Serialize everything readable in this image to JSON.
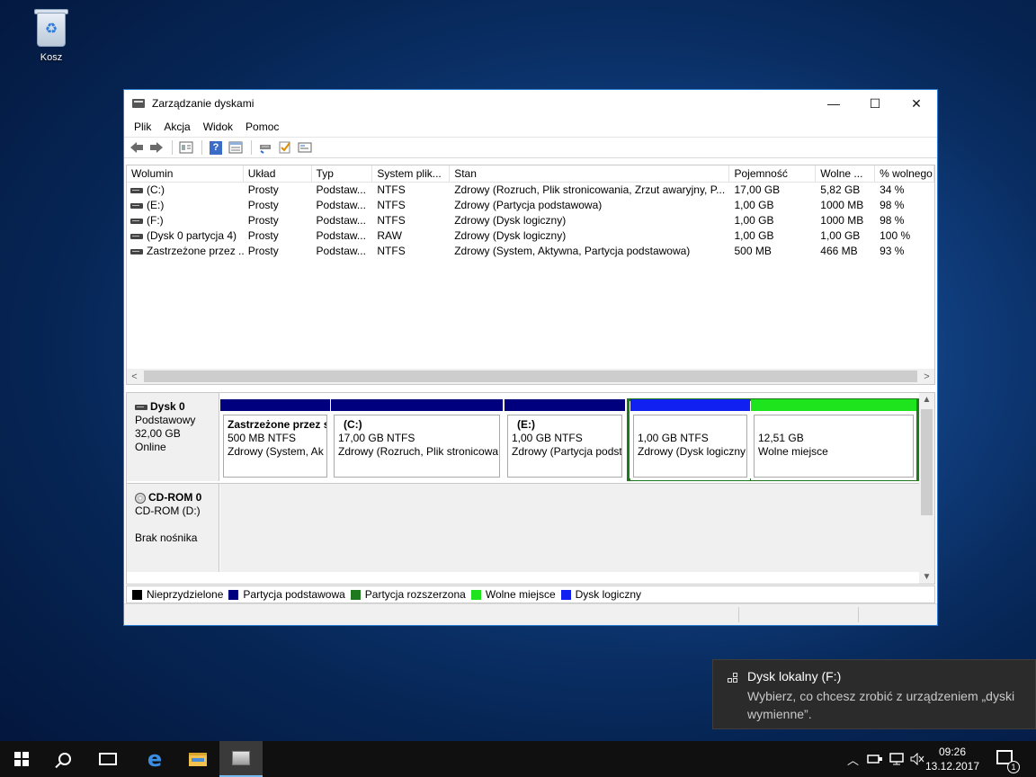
{
  "desktop": {
    "recycle_bin_label": "Kosz"
  },
  "window": {
    "title": "Zarządzanie dyskami",
    "controls": {
      "minimize": "—",
      "maximize": "☐",
      "close": "✕"
    },
    "menu": [
      "Plik",
      "Akcja",
      "Widok",
      "Pomoc"
    ],
    "toolbar_icons": [
      "back-icon",
      "forward-icon",
      "properties-icon",
      "help-icon",
      "list-view-icon",
      "connect-icon",
      "check-icon",
      "settings-icon"
    ]
  },
  "volume_list": {
    "columns": [
      "Wolumin",
      "Układ",
      "Typ",
      "System plik...",
      "Stan",
      "Pojemność",
      "Wolne ...",
      "% wolnego"
    ],
    "rows": [
      [
        "(C:)",
        "Prosty",
        "Podstaw...",
        "NTFS",
        "Zdrowy (Rozruch, Plik stronicowania, Zrzut awaryjny, P...",
        "17,00 GB",
        "5,82 GB",
        "34 %"
      ],
      [
        "(E:)",
        "Prosty",
        "Podstaw...",
        "NTFS",
        "Zdrowy (Partycja podstawowa)",
        "1,00 GB",
        "1000 MB",
        "98 %"
      ],
      [
        "(F:)",
        "Prosty",
        "Podstaw...",
        "NTFS",
        "Zdrowy (Dysk logiczny)",
        "1,00 GB",
        "1000 MB",
        "98 %"
      ],
      [
        "(Dysk 0 partycja 4)",
        "Prosty",
        "Podstaw...",
        "RAW",
        "Zdrowy (Dysk logiczny)",
        "1,00 GB",
        "1,00 GB",
        "100 %"
      ],
      [
        "Zastrzeżone przez ...",
        "Prosty",
        "Podstaw...",
        "NTFS",
        "Zdrowy (System, Aktywna, Partycja podstawowa)",
        "500 MB",
        "466 MB",
        "93 %"
      ]
    ]
  },
  "disks": [
    {
      "name": "Dysk 0",
      "lines": [
        "Podstawowy",
        "32,00 GB",
        "Online"
      ],
      "partitions": [
        {
          "title": "Zastrzeżone przez s",
          "size": "500 MB NTFS",
          "status": "Zdrowy (System, Ak"
        },
        {
          "title": "(C:)",
          "size": "17,00 GB NTFS",
          "status": "Zdrowy (Rozruch, Plik stronicowa"
        },
        {
          "title": "(E:)",
          "size": "1,00 GB NTFS",
          "status": "Zdrowy (Partycja podst"
        },
        {
          "title": "",
          "size": "1,00 GB NTFS",
          "status": "Zdrowy (Dysk logiczny"
        },
        {
          "title": "",
          "size": "12,51 GB",
          "status": "Wolne miejsce"
        }
      ]
    },
    {
      "name": "CD-ROM 0",
      "lines": [
        "CD-ROM (D:)",
        "",
        "Brak nośnika"
      ]
    }
  ],
  "colors": {
    "primary_partition": "#00007f",
    "logical_drive": "#1020f0",
    "free_space": "#1ee41e",
    "extended_partition": "#1f7a1f",
    "unallocated": "#000000"
  },
  "legend": [
    {
      "label": "Nieprzydzielone",
      "color": "#000000"
    },
    {
      "label": "Partycja podstawowa",
      "color": "#00007f"
    },
    {
      "label": "Partycja rozszerzona",
      "color": "#1f7a1f"
    },
    {
      "label": "Wolne miejsce",
      "color": "#1ee41e"
    },
    {
      "label": "Dysk logiczny",
      "color": "#1020f0"
    }
  ],
  "toast": {
    "title": "Dysk lokalny (F:)",
    "body": "Wybierz, co chcesz zrobić z urządzeniem „dyski wymienne”."
  },
  "taskbar": {
    "time": "09:26",
    "date": "13.12.2017",
    "notification_count": "1"
  }
}
